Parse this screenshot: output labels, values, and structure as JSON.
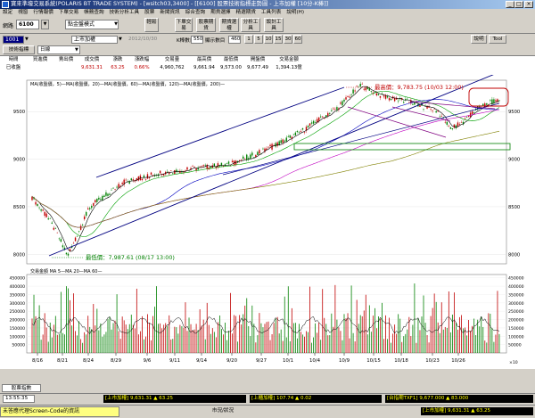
{
  "window": {
    "title": "寶來準壕交易系統(POLARIS BT TRADE SYSTEM) - [wsitch03,3400] - [[6100] 股票技術指標走勢圖 - 上市加權 [10分-K棒]]",
    "min": "_",
    "max": "□",
    "close": "×"
  },
  "menu": [
    "設定",
    "視窗",
    "行情報價",
    "下單交易",
    "帳務查詢",
    "技術分析工具",
    "股票",
    "新聞資訊",
    "綜合查詢",
    "期貨選擇",
    "精選期貨",
    "工具列表",
    "說明(H)"
  ],
  "toolbar": {
    "code_label": "網路",
    "code_value": "6100",
    "mode_value": "點金盤模式",
    "buttons": [
      "輕鬆",
      "下單交易",
      "股票期貨",
      "期貨選權",
      "分析工具",
      "設計工具"
    ]
  },
  "toolbar2": {
    "stock_code": "1001",
    "stock_name": "上市加權",
    "date_range": "2012/10/30",
    "bars_label": "K棒數目",
    "bars_value": "550",
    "period_label": "顯示數目",
    "period_value": "460",
    "period_buttons": [
      "1",
      "5",
      "10",
      "15",
      "30",
      "60"
    ],
    "right_buttons": [
      "說明",
      "Tool"
    ]
  },
  "toolbar3": {
    "indicator_label": "技術指標",
    "interval_value": "日線"
  },
  "table": {
    "headers": [
      "時間",
      "買進價",
      "賣出價",
      "成交價",
      "漲跌",
      "漲跌幅",
      "交易量",
      "最高價",
      "最低價",
      "開盤價",
      "交易金額"
    ],
    "values": [
      "已收盤",
      "",
      "",
      "9,631.31",
      "63.25",
      "0.66%",
      "4,960,762",
      "9,661.94",
      "9,573.00",
      "9,677.49",
      "1,394.13億"
    ]
  },
  "chart": {
    "ma_legend": "MA(收盤價，5)—MA(收盤價，20)—MA(收盤價，60)—MA(收盤價，120)—MA(收盤價，200)—",
    "high_label": "最高價：9,783.75 (10/03 12:00)",
    "low_label": "最低價：7,987.61 (08/17 13:00)",
    "price_ticks": [
      "9500",
      "9000",
      "8500",
      "8000"
    ],
    "volume_legend": "交易金額  MA  5—MA  20—MA  60—",
    "volume_ticks": [
      "450000",
      "400000",
      "350000",
      "300000",
      "250000",
      "200000",
      "150000",
      "100000",
      "50000"
    ],
    "volume_unit": "×10",
    "date_ticks": [
      "8/16",
      "8/21",
      "8/24",
      "8/29",
      "9/6",
      "9/11",
      "9/14",
      "9/20",
      "9/27",
      "10/1",
      "10/4",
      "10/9",
      "10/15",
      "10/18",
      "10/23",
      "10/26"
    ]
  },
  "bottom": {
    "tab_label": "股票指數",
    "time": "13:55:35",
    "stat_main": "[上市加權] 9,631.31  ▲ 63.25",
    "stat_otc": "[上櫃加權] 107.74  ▲ 0.02",
    "stat_fut": "[台指期TXF1] 9,677.000  ▲ 83.000",
    "status_left": "未答應代理Screen-Code的資訊",
    "status_mid": "市況/狀況",
    "status_right": "[上市加權] 9,631.31  ▲ 63.25"
  },
  "colors": {
    "up": "#c00000",
    "down": "#008000",
    "channel": "#000080",
    "highlight": "#c00000",
    "ma5": "#000000",
    "ma20": "#00a000",
    "ma60": "#0000c0",
    "ma120": "#c000c0",
    "ma200": "#808000"
  }
}
